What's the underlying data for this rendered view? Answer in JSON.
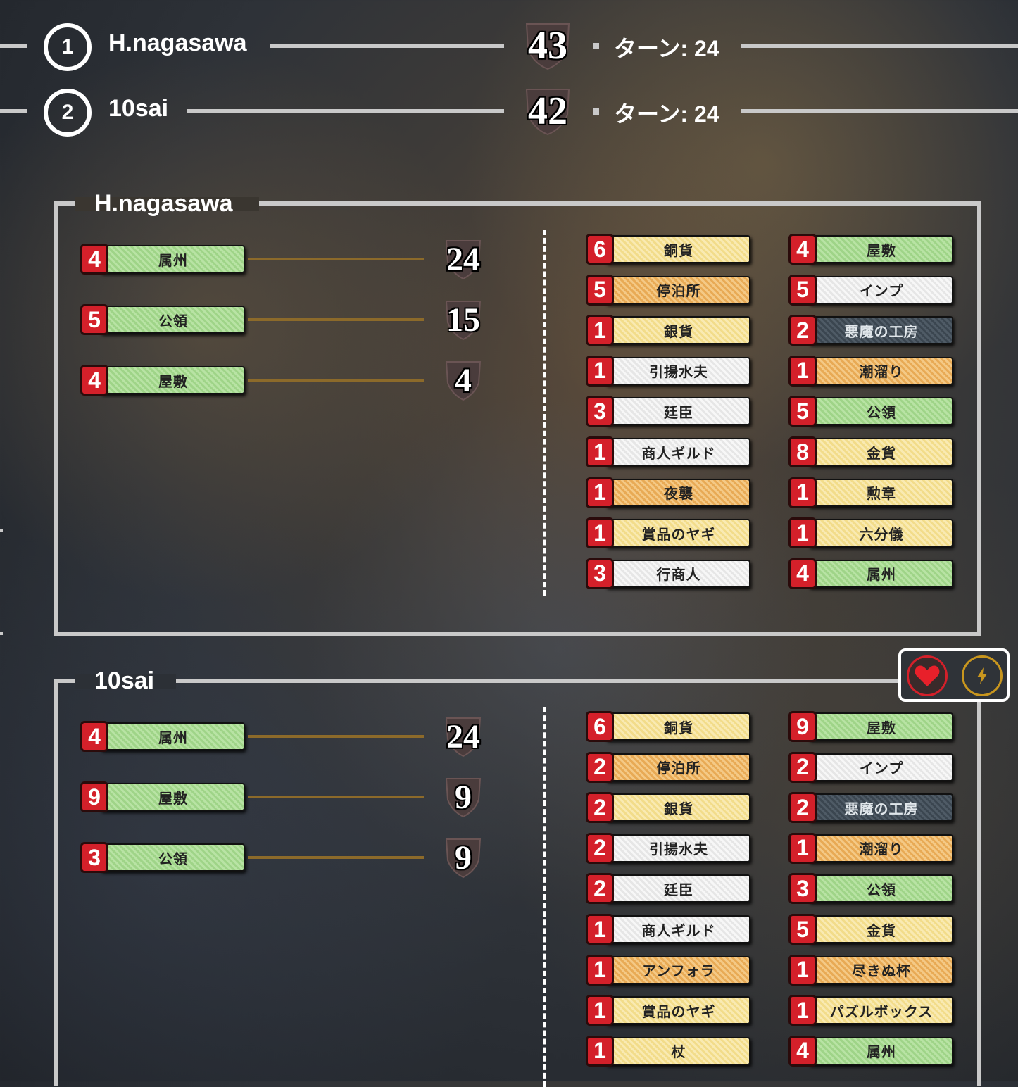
{
  "rankings": [
    {
      "rank": "1",
      "name": "H.nagasawa",
      "score": "43",
      "turn_label": "ターン: 24"
    },
    {
      "rank": "2",
      "name": "10sai",
      "score": "42",
      "turn_label": "ターン: 24"
    }
  ],
  "players": [
    {
      "name": "H.nagasawa",
      "summary": [
        {
          "count": "4",
          "label": "属州",
          "color": "green",
          "points": "24"
        },
        {
          "count": "5",
          "label": "公領",
          "color": "green",
          "points": "15"
        },
        {
          "count": "4",
          "label": "屋敷",
          "color": "green",
          "points": "4"
        }
      ],
      "deck_col1": [
        {
          "count": "6",
          "label": "銅貨",
          "color": "yellow"
        },
        {
          "count": "5",
          "label": "停泊所",
          "color": "orange"
        },
        {
          "count": "1",
          "label": "銀貨",
          "color": "yellow"
        },
        {
          "count": "1",
          "label": "引揚水夫",
          "color": "white"
        },
        {
          "count": "3",
          "label": "廷臣",
          "color": "white"
        },
        {
          "count": "1",
          "label": "商人ギルド",
          "color": "white"
        },
        {
          "count": "1",
          "label": "夜襲",
          "color": "orange"
        },
        {
          "count": "1",
          "label": "賞品のヤギ",
          "color": "yellow"
        },
        {
          "count": "3",
          "label": "行商人",
          "color": "white"
        }
      ],
      "deck_col2": [
        {
          "count": "4",
          "label": "屋敷",
          "color": "green"
        },
        {
          "count": "5",
          "label": "インプ",
          "color": "white"
        },
        {
          "count": "2",
          "label": "悪魔の工房",
          "color": "dark"
        },
        {
          "count": "1",
          "label": "潮溜り",
          "color": "orange"
        },
        {
          "count": "5",
          "label": "公領",
          "color": "green"
        },
        {
          "count": "8",
          "label": "金貨",
          "color": "yellow"
        },
        {
          "count": "1",
          "label": "勲章",
          "color": "yellow"
        },
        {
          "count": "1",
          "label": "六分儀",
          "color": "yellow"
        },
        {
          "count": "4",
          "label": "属州",
          "color": "green"
        }
      ]
    },
    {
      "name": "10sai",
      "summary": [
        {
          "count": "4",
          "label": "属州",
          "color": "green",
          "points": "24"
        },
        {
          "count": "9",
          "label": "屋敷",
          "color": "green",
          "points": "9"
        },
        {
          "count": "3",
          "label": "公領",
          "color": "green",
          "points": "9"
        }
      ],
      "deck_col1": [
        {
          "count": "6",
          "label": "銅貨",
          "color": "yellow"
        },
        {
          "count": "2",
          "label": "停泊所",
          "color": "orange"
        },
        {
          "count": "2",
          "label": "銀貨",
          "color": "yellow"
        },
        {
          "count": "2",
          "label": "引揚水夫",
          "color": "white"
        },
        {
          "count": "2",
          "label": "廷臣",
          "color": "white"
        },
        {
          "count": "1",
          "label": "商人ギルド",
          "color": "white"
        },
        {
          "count": "1",
          "label": "アンフォラ",
          "color": "orange"
        },
        {
          "count": "1",
          "label": "賞品のヤギ",
          "color": "yellow"
        },
        {
          "count": "1",
          "label": "杖",
          "color": "yellow"
        }
      ],
      "deck_col2": [
        {
          "count": "9",
          "label": "屋敷",
          "color": "green"
        },
        {
          "count": "2",
          "label": "インプ",
          "color": "white"
        },
        {
          "count": "2",
          "label": "悪魔の工房",
          "color": "dark"
        },
        {
          "count": "1",
          "label": "潮溜り",
          "color": "orange"
        },
        {
          "count": "3",
          "label": "公領",
          "color": "green"
        },
        {
          "count": "5",
          "label": "金貨",
          "color": "yellow"
        },
        {
          "count": "1",
          "label": "尽きぬ杯",
          "color": "orange"
        },
        {
          "count": "1",
          "label": "パズルボックス",
          "color": "yellow"
        },
        {
          "count": "4",
          "label": "属州",
          "color": "green"
        }
      ]
    }
  ],
  "reactions": {
    "heart_icon": "heart-icon",
    "lightning_icon": "lightning-icon",
    "heart_color": "#d4202a",
    "lightning_color": "#c8961e"
  }
}
